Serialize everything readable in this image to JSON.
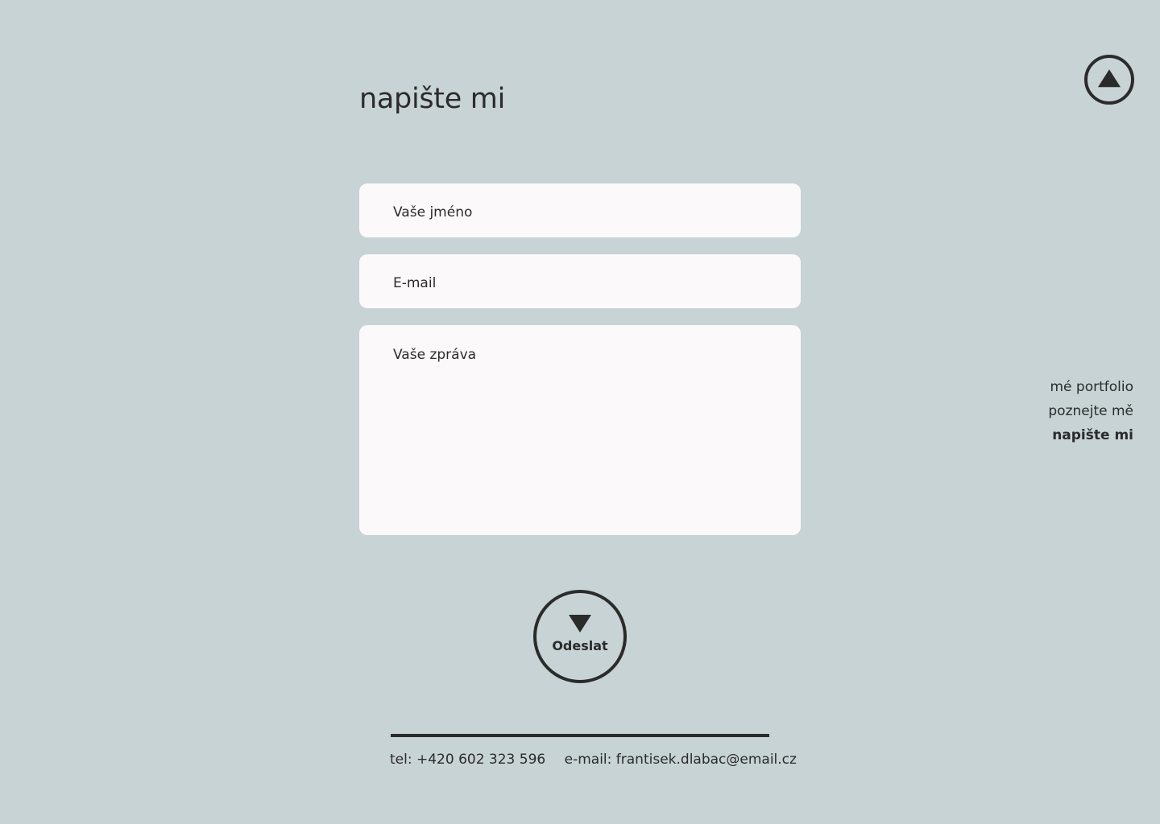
{
  "page": {
    "title": "napište mi"
  },
  "form": {
    "name_placeholder": "Vaše jméno",
    "email_placeholder": "E-mail",
    "message_placeholder": "Vaše zpráva",
    "submit_label": "Odeslat"
  },
  "nav": {
    "items": [
      {
        "label": "mé portfolio",
        "active": false
      },
      {
        "label": "poznejte mě",
        "active": false
      },
      {
        "label": "napište mi",
        "active": true
      }
    ]
  },
  "footer": {
    "phone": "tel: +420 602 323 596",
    "email": "e-mail: frantisek.dlabac@email.cz"
  },
  "icons": {
    "scroll_top": "triangle-up-in-circle-icon",
    "submit": "triangle-down-icon"
  },
  "colors": {
    "background": "#c7d3d5",
    "text": "#2b2b2b",
    "field": "#fbf9fa"
  }
}
